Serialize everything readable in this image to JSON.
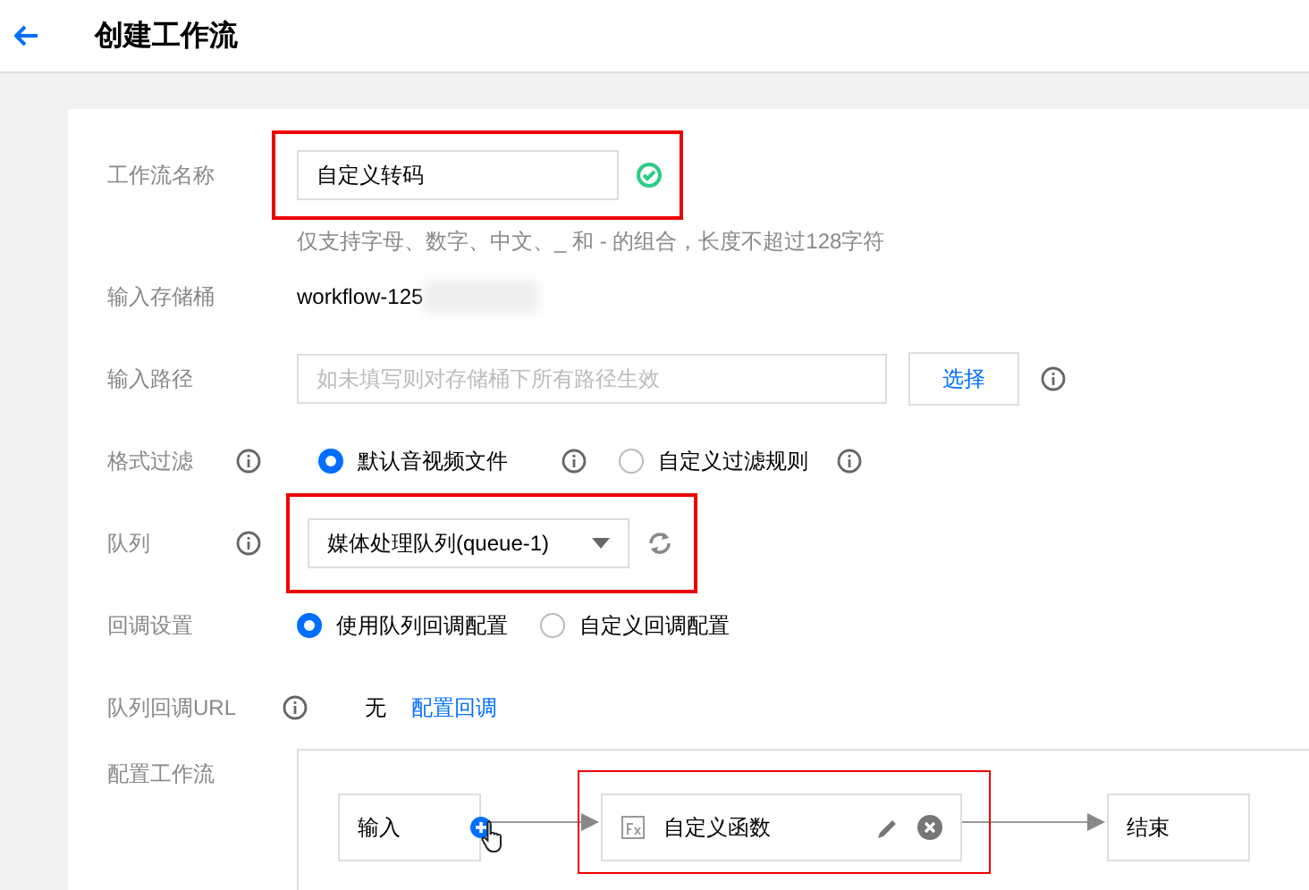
{
  "header": {
    "title": "创建工作流"
  },
  "name": {
    "label": "工作流名称",
    "value": "自定义转码",
    "valid": true,
    "highlighted": true,
    "hint": "仅支持字母、数字、中文、_ 和 - 的组合，长度不超过128字符"
  },
  "bucket": {
    "label": "输入存储桶",
    "value": "workflow-125",
    "redacted": true
  },
  "path": {
    "label": "输入路径",
    "placeholder": "如未填写则对存储桶下所有路径生效",
    "button": "选择"
  },
  "format": {
    "label": "格式过滤",
    "options": [
      {
        "label": "默认音视频文件",
        "selected": true
      },
      {
        "label": "自定义过滤规则",
        "selected": false
      }
    ]
  },
  "queue": {
    "label": "队列",
    "value": "媒体处理队列(queue-1)",
    "highlighted": true
  },
  "callback": {
    "label": "回调设置",
    "options": [
      {
        "label": "使用队列回调配置",
        "selected": true
      },
      {
        "label": "自定义回调配置",
        "selected": false
      }
    ]
  },
  "queue_url": {
    "label": "队列回调URL",
    "value": "无",
    "link": "配置回调"
  },
  "workflow": {
    "label": "配置工作流",
    "nodes": [
      {
        "kind": "input",
        "label": "输入",
        "highlighted": false
      },
      {
        "kind": "function",
        "label": "自定义函数",
        "highlighted": true
      },
      {
        "kind": "end",
        "label": "结束",
        "highlighted": false
      }
    ]
  }
}
